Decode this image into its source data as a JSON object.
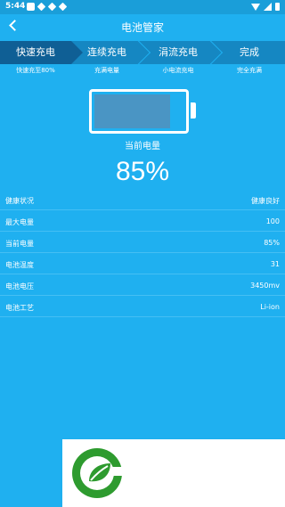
{
  "status_bar": {
    "time": "5:44"
  },
  "header": {
    "title": "电池管家"
  },
  "steps": [
    {
      "label": "快速充电",
      "sub": "快速充至80%"
    },
    {
      "label": "连续充电",
      "sub": "充满电量"
    },
    {
      "label": "涓流充电",
      "sub": "小电流充电"
    },
    {
      "label": "完成",
      "sub": "完全充满"
    }
  ],
  "battery": {
    "label": "当前电量",
    "level_text": "85%",
    "level": 0.85
  },
  "rows": [
    {
      "label": "健康状况",
      "value": "健康良好"
    },
    {
      "label": "最大电量",
      "value": "100"
    },
    {
      "label": "当前电量",
      "value": "85%"
    },
    {
      "label": "电池温度",
      "value": "31"
    },
    {
      "label": "电池电压",
      "value": "3450mv"
    },
    {
      "label": "电池工艺",
      "value": "Li-ion"
    }
  ],
  "colors": {
    "background": "#1fb0f0",
    "step_bar": "#1587c2",
    "step_active": "#0f5f95",
    "logo_green": "#2e9b2f"
  },
  "ad": {
    "icon": "leaf-logo-icon"
  }
}
